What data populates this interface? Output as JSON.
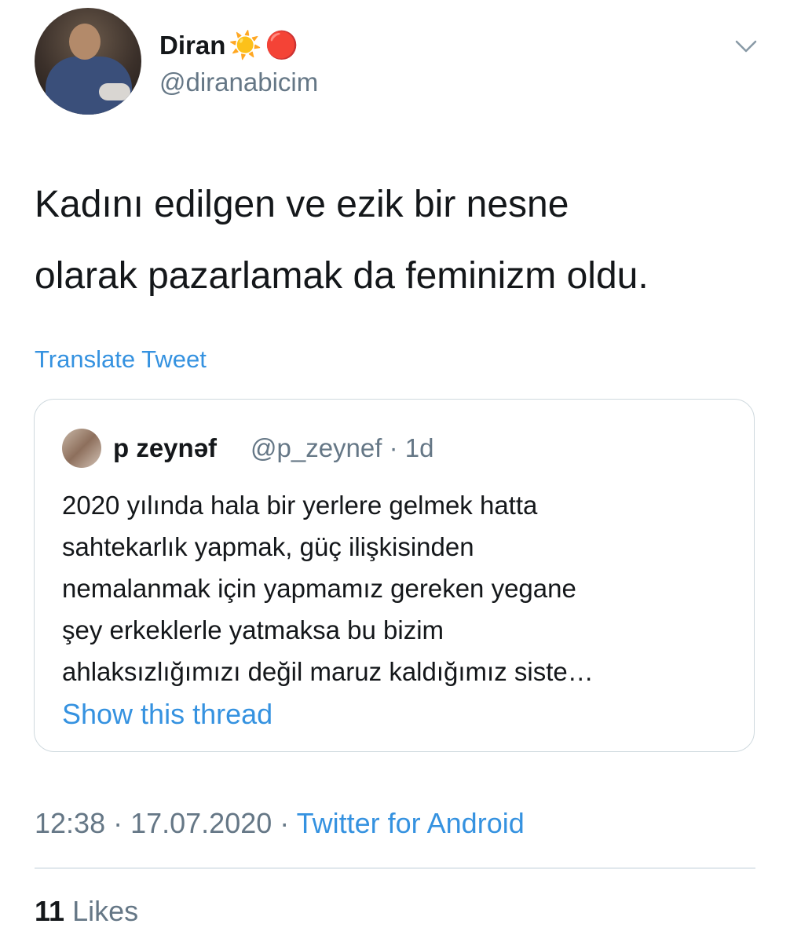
{
  "author": {
    "name": "Diran",
    "name_emojis": [
      "☀️",
      "🔴"
    ],
    "handle": "@diranabicim"
  },
  "tweet": {
    "text": "Kadını edilgen ve ezik bir nesne\nolarak pazarlamak da feminizm oldu.",
    "translate_label": "Translate Tweet"
  },
  "quoted_tweet": {
    "name": "p zeynəf",
    "handle_time": "@p_zeynef · 1d",
    "text": "2020 yılında hala bir yerlere gelmek hatta\nsahtekarlık yapmak, güç ilişkisinden\nnemalanmak için yapmamız gereken yegane\nşey erkeklerle yatmaksa bu bizim\nahlaksızlığımızı değil maruz kaldığımız siste…",
    "show_thread_label": "Show this thread"
  },
  "meta": {
    "timestamp": "12:38 · 17.07.2020 · ",
    "source": "Twitter for Android"
  },
  "stats": {
    "likes_count": "11",
    "likes_label": "Likes"
  },
  "colors": {
    "link": "#3592e0",
    "secondary_text": "#657786",
    "primary_text": "#14171a",
    "border": "#cfd9de"
  },
  "icons": [
    "chevron-down-icon"
  ]
}
